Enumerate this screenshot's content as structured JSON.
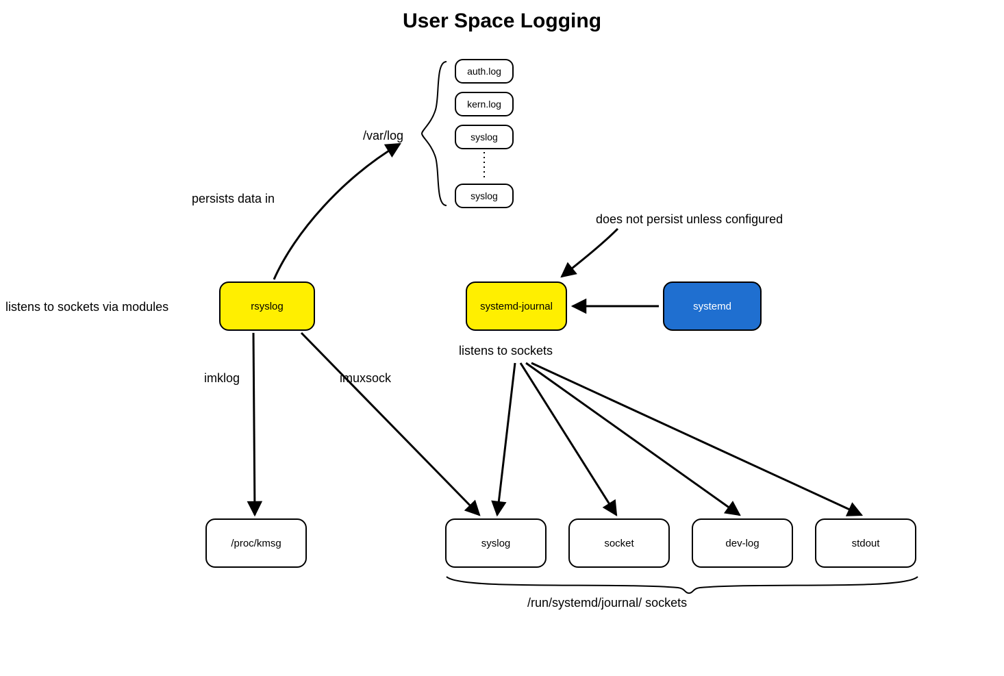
{
  "title": "User Space Logging",
  "nodes": {
    "rsyslog": "rsyslog",
    "systemd_journal": "systemd-journal",
    "systemd": "systemd",
    "proc_kmsg": "/proc/kmsg",
    "syslog_socket": "syslog",
    "socket_socket": "socket",
    "devlog_socket": "dev-log",
    "stdout_socket": "stdout"
  },
  "logfiles": {
    "auth": "auth.log",
    "kern": "kern.log",
    "syslog1": "syslog",
    "syslog2": "syslog"
  },
  "labels": {
    "varlog": "/var/log",
    "persists": "persists data in",
    "listens_modules": "listens to sockets via modules",
    "imklog": "imklog",
    "imuxsock": "imuxsock",
    "listens_sockets": "listens to sockets",
    "no_persist": "does not persist unless configured",
    "run_path": "/run/systemd/journal/ sockets"
  }
}
